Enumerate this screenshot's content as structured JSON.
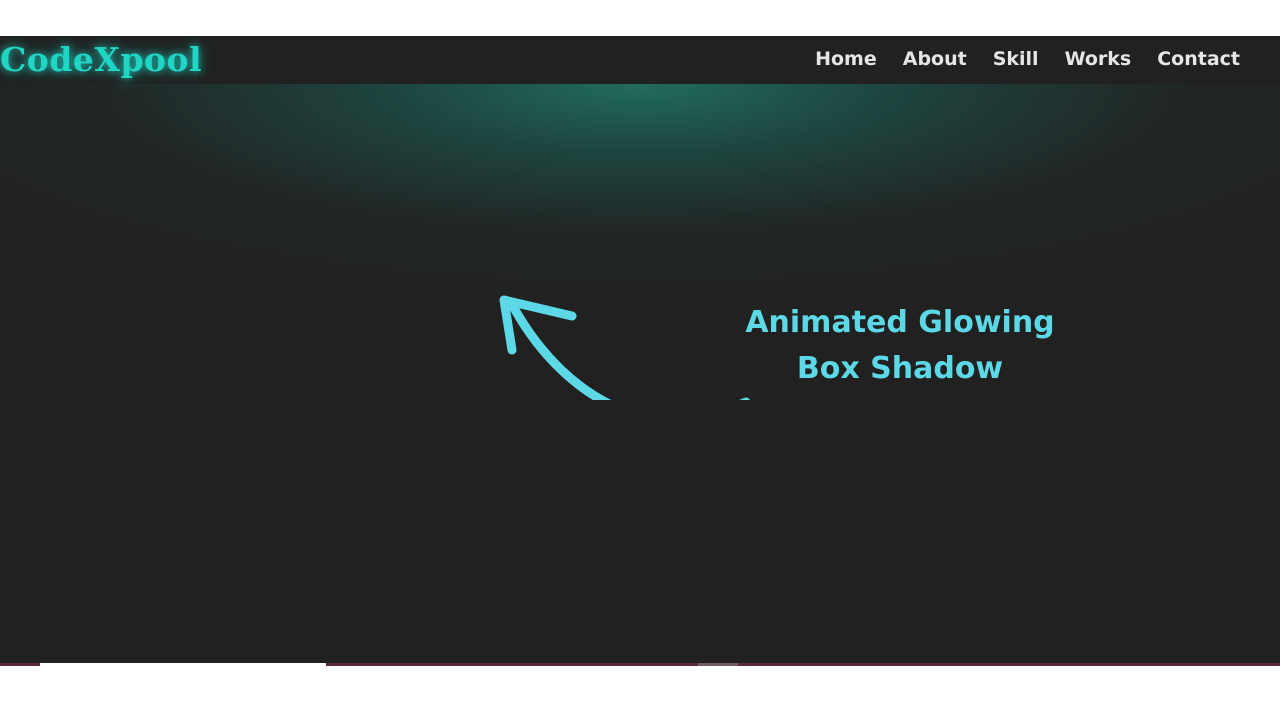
{
  "brand": {
    "logo_text": "CodeXpool"
  },
  "nav": {
    "items": [
      {
        "label": "Home"
      },
      {
        "label": "About"
      },
      {
        "label": "Skill"
      },
      {
        "label": "Works"
      },
      {
        "label": "Contact"
      }
    ]
  },
  "annotation": {
    "line1": "Animated Glowing",
    "line2": "Box Shadow",
    "arrow_icon": "curved-arrow-icon"
  },
  "colors": {
    "background": "#212121",
    "brand_accent": "#1fd6c4",
    "glow": "#207868",
    "annotation": "#5dd8e6",
    "nav_text": "#e6e6e6"
  }
}
